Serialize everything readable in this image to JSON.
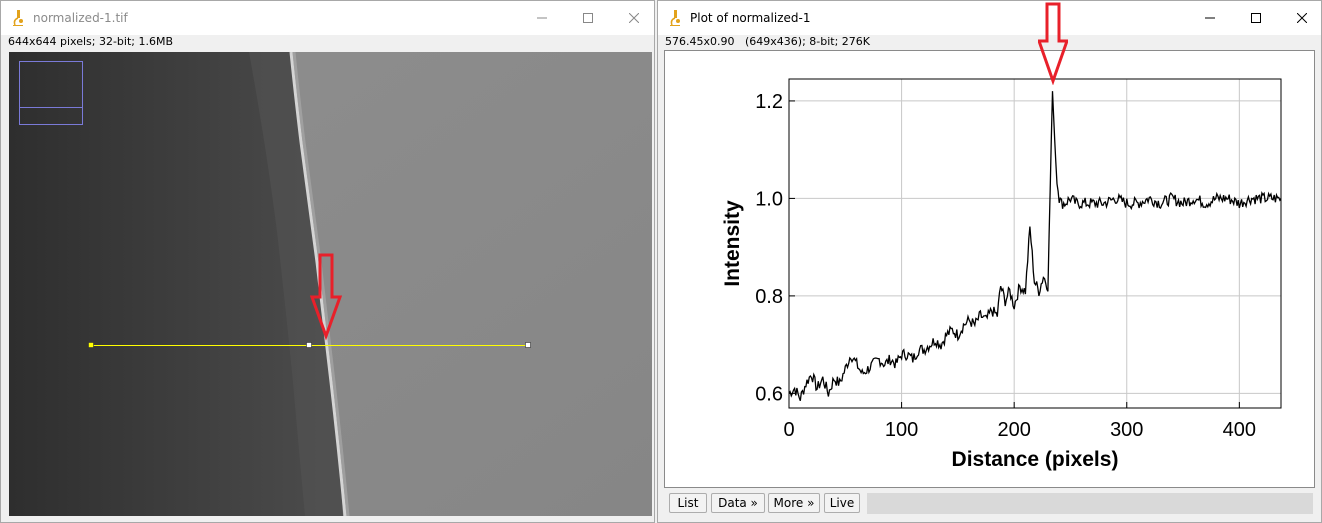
{
  "left_window": {
    "title": "normalized-1.tif",
    "status": "644x644 pixels; 32-bit; 1.6MB"
  },
  "right_window": {
    "title": "Plot of normalized-1",
    "status": "576.45x0.90   (649x436); 8-bit; 276K",
    "buttons": {
      "list": "List",
      "data": "Data »",
      "more": "More »",
      "live": "Live"
    }
  },
  "colors": {
    "selection_line": "#ffff00",
    "arrow": "#e8202a",
    "overlay_box": "#7a7ad8"
  },
  "icons": [
    "microscope-icon",
    "minimize-icon",
    "maximize-icon",
    "close-icon"
  ],
  "chart_data": {
    "type": "line",
    "xlabel": "Distance (pixels)",
    "ylabel": "Intensity",
    "xlim": [
      0,
      437
    ],
    "ylim": [
      0.57,
      1.245
    ],
    "grid": true,
    "x_ticks": [
      0,
      100,
      200,
      300,
      400
    ],
    "y_ticks": [
      0.6,
      0.8,
      1.0,
      1.2
    ],
    "x_tick_labels": [
      "0",
      "100",
      "200",
      "300",
      "400"
    ],
    "y_tick_labels": [
      "0.6",
      "0.8",
      "1.0",
      "1.2"
    ],
    "series": [
      {
        "x": [
          0,
          5,
          10,
          15,
          20,
          25,
          30,
          35,
          40,
          45,
          50,
          55,
          60,
          65,
          70,
          75,
          80,
          85,
          90,
          95,
          100,
          105,
          110,
          115,
          120,
          125,
          130,
          135,
          140,
          145,
          150,
          155,
          160,
          165,
          170,
          175,
          180,
          185,
          188,
          192,
          196,
          200,
          205,
          210,
          214,
          218,
          222,
          226,
          230,
          234,
          236,
          238,
          240,
          242,
          245,
          250,
          255,
          260,
          270,
          280,
          290,
          300,
          310,
          320,
          330,
          340,
          350,
          360,
          370,
          380,
          390,
          400,
          410,
          420,
          430,
          437
        ],
        "y": [
          0.6,
          0.61,
          0.59,
          0.62,
          0.64,
          0.61,
          0.63,
          0.6,
          0.63,
          0.62,
          0.65,
          0.68,
          0.66,
          0.64,
          0.65,
          0.66,
          0.67,
          0.66,
          0.67,
          0.66,
          0.68,
          0.68,
          0.67,
          0.69,
          0.69,
          0.7,
          0.71,
          0.7,
          0.72,
          0.73,
          0.72,
          0.74,
          0.75,
          0.74,
          0.76,
          0.75,
          0.77,
          0.76,
          0.82,
          0.79,
          0.81,
          0.78,
          0.82,
          0.81,
          0.94,
          0.83,
          0.81,
          0.84,
          0.82,
          1.22,
          1.12,
          1.03,
          1.0,
          0.99,
          0.99,
          1.0,
          0.99,
          0.99,
          0.99,
          0.99,
          1.0,
          0.99,
          0.99,
          1.0,
          0.99,
          1.0,
          0.99,
          1.0,
          0.99,
          1.0,
          1.0,
          0.99,
          1.0,
          1.0,
          1.0,
          1.0
        ]
      }
    ]
  }
}
